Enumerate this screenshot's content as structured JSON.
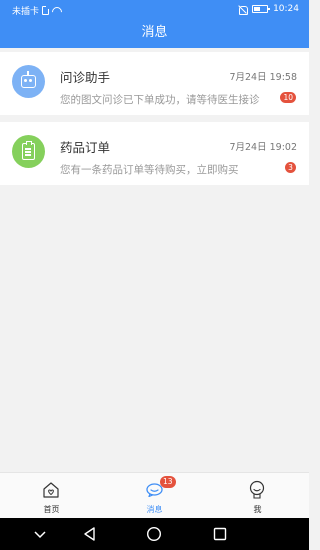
{
  "status_bar": {
    "carrier": "未插卡",
    "time": "10:24",
    "icons": [
      "sim-icon",
      "wifi-icon",
      "bell-off-icon",
      "battery-icon"
    ]
  },
  "header": {
    "title": "消息",
    "background": "#3f8ef5"
  },
  "messages": [
    {
      "title": "问诊助手",
      "time": "7月24日 19:58",
      "preview": "您的图文问诊已下单成功，请等待医生接诊",
      "badge": "10",
      "icon": "robot-icon",
      "avatar_color": "#7db2f5"
    },
    {
      "title": "药品订单",
      "time": "7月24日 19:02",
      "preview": "您有一条药品订单等待购买，立即购买",
      "badge": "3",
      "icon": "order-icon",
      "avatar_color": "#85d05c"
    }
  ],
  "tab_bar": {
    "tabs": [
      {
        "label": "首页",
        "icon": "home-icon",
        "active": false
      },
      {
        "label": "消息",
        "icon": "chat-icon",
        "active": true,
        "badge": "13"
      },
      {
        "label": "我",
        "icon": "user-icon",
        "active": false
      }
    ],
    "active_color": "#3f8ef5",
    "badge_color": "#e4523d"
  },
  "nav_bar": {
    "buttons": [
      "chevron-down-icon",
      "back-icon",
      "home-circle-icon",
      "recents-icon"
    ]
  }
}
